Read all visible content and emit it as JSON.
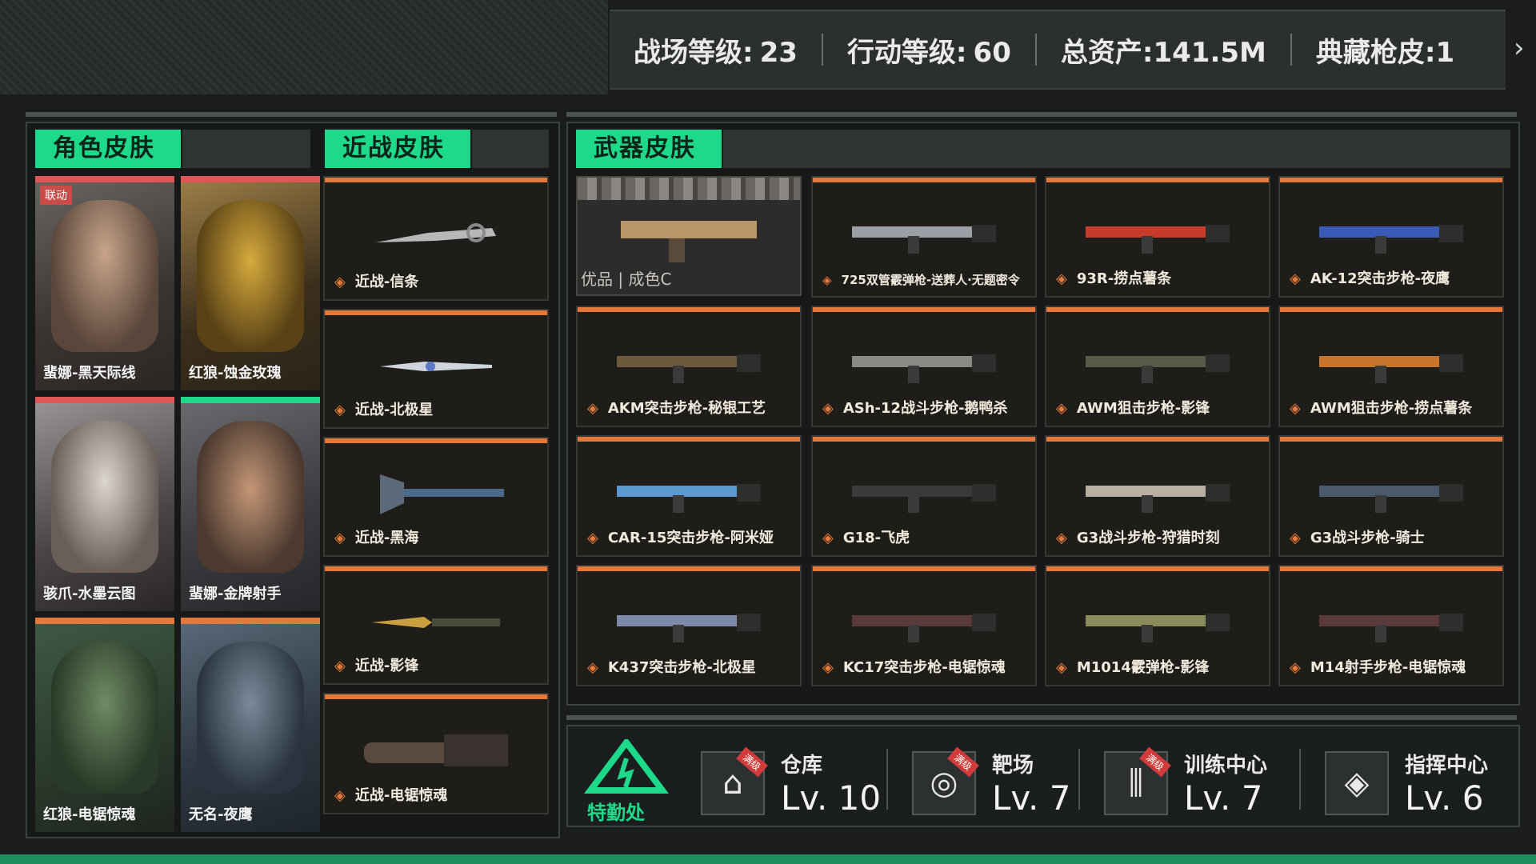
{
  "stats": {
    "battle_level_label": "战场等级:",
    "battle_level": "23",
    "action_level_label": "行动等级:",
    "action_level": "60",
    "assets_label": "总资产:",
    "assets": "141.5M",
    "collection_label": "典藏枪皮:",
    "collection": "1"
  },
  "sections": {
    "character": "角色皮肤",
    "melee": "近战皮肤",
    "weapon": "武器皮肤"
  },
  "characters": [
    {
      "name": "蜚娜-黑天际线",
      "badge": "联动",
      "bar": "#e05656"
    },
    {
      "name": "红狼-蚀金玫瑰",
      "bar": "#e05656"
    },
    {
      "name": "骇爪-水墨云图",
      "bar": "#e05656"
    },
    {
      "name": "蜚娜-金牌射手",
      "bar": "#1fd98a"
    },
    {
      "name": "红狼-电锯惊魂",
      "bar": "#e37a3b"
    },
    {
      "name": "无名-夜鹰",
      "bar": "#e37a3b"
    }
  ],
  "melee": [
    {
      "name": "近战-信条"
    },
    {
      "name": "近战-北极星"
    },
    {
      "name": "近战-黑海"
    },
    {
      "name": "近战-影锋"
    },
    {
      "name": "近战-电锯惊魂"
    }
  ],
  "featured_weapon": {
    "label": "优品 | 成色C"
  },
  "weapons": [
    {
      "name": "725双管霰弹枪-送葬人·无题密令",
      "small": true
    },
    {
      "name": "93R-捞点薯条"
    },
    {
      "name": "AK-12突击步枪-夜鹰"
    },
    {
      "name": "AKM突击步枪-秘银工艺"
    },
    {
      "name": "ASh-12战斗步枪-鹅鸭杀"
    },
    {
      "name": "AWM狙击步枪-影锋"
    },
    {
      "name": "AWM狙击步枪-捞点薯条"
    },
    {
      "name": "CAR-15突击步枪-阿米娅"
    },
    {
      "name": "G18-飞虎"
    },
    {
      "name": "G3战斗步枪-狩猎时刻"
    },
    {
      "name": "G3战斗步枪-骑士"
    },
    {
      "name": "K437突击步枪-北极星"
    },
    {
      "name": "KC17突击步枪-电锯惊魂"
    },
    {
      "name": "M1014霰弹枪-影锋"
    },
    {
      "name": "M14射手步枪-电锯惊魂"
    }
  ],
  "facilities": {
    "logo_label": "特勤处",
    "items": [
      {
        "name": "仓库",
        "level": "Lv. 10",
        "ribbon": "满级",
        "icon": "warehouse-icon"
      },
      {
        "name": "靶场",
        "level": "Lv. 7",
        "ribbon": "满级",
        "icon": "target-icon"
      },
      {
        "name": "训练中心",
        "level": "Lv. 7",
        "ribbon": "满级",
        "icon": "dumbbell-icon"
      },
      {
        "name": "指挥中心",
        "level": "Lv. 6",
        "icon": "command-icon"
      }
    ]
  },
  "colors": {
    "accent": "#1fd98a",
    "orange": "#e37a3b",
    "red": "#e05656"
  }
}
